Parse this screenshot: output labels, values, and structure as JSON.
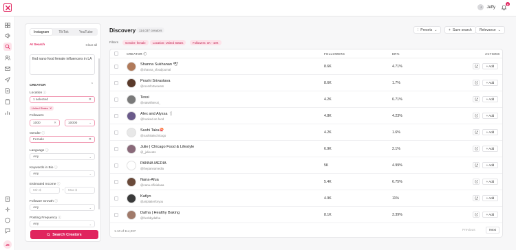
{
  "app": {
    "user_name": "Jeffy",
    "user_initial": "J",
    "notification_count": "8",
    "me_initials": "JE"
  },
  "filters_panel": {
    "tabs": [
      {
        "label": "Instagram",
        "active": true
      },
      {
        "label": "TikTok",
        "active": false
      },
      {
        "label": "YouTube",
        "active": false
      }
    ],
    "ai_search_label": "AI Search",
    "clear_all": "Clear all",
    "ai_query": "find nano food female influencers in LA",
    "creator_section": "CREATOR",
    "location_label": "Location",
    "location_value": "1 selected",
    "location_chip": "United States",
    "followers_label": "Followers",
    "followers_min": "1000",
    "followers_max": "10000",
    "gender_label": "Gender",
    "gender_value": "Female",
    "language_label": "Language",
    "language_value": "Any",
    "keywords_label": "Keywords in Bio",
    "keywords_value": "Any",
    "income_label": "Estimated Income",
    "income_min_placeholder": "Min $",
    "income_max_placeholder": "Max $",
    "growth_label": "Follower Growth",
    "growth_value": "Any",
    "posting_label": "Posting Frequency",
    "posting_value": "Any",
    "search_button": "Search Creators"
  },
  "main": {
    "title": "Discovery",
    "count_badge": "114,037 creators",
    "presets_button": "Presets",
    "save_search_button": "Save search",
    "relevance_button": "Relevance",
    "filters_label": "Filters",
    "filter_chips": [
      "Gender: female",
      "Location: United States",
      "Followers: 1K - 10K"
    ],
    "columns": {
      "creator": "CREATOR",
      "followers": "FOLLOWERS",
      "er": "ER%",
      "actions": "ACTIONS"
    },
    "add_label": "+ Add",
    "rows": [
      {
        "name": "Shanna Sukhanan 🕊",
        "handle": "@shanna_sfoodjournal",
        "followers": "8.6K",
        "er": "4.71%",
        "color": "#b07a5a"
      },
      {
        "name": "Prashi Srivastava",
        "handle": "@roomfortwoeats",
        "followers": "8.6K",
        "er": "1.7%",
        "color": "#5a3a2a"
      },
      {
        "name": "Tessi",
        "handle": "@eatwithtessi_",
        "followers": "4.2K",
        "er": "6.71%",
        "color": "#7a7a7a"
      },
      {
        "name": "Alex and Alyssa 🍴",
        "handle": "@hooked.on.food",
        "followers": "4.8K",
        "er": "4.23%",
        "color": "#6a5a8a"
      },
      {
        "name": "Sushi Taku🍣",
        "handle": "@sushitakuchicago",
        "followers": "4.2K",
        "er": "1.6%",
        "color": "#e8e8e8"
      },
      {
        "name": "Julie | Chicago Food & Lifestyle",
        "handle": "@_julieeats",
        "followers": "6.9K",
        "er": "2.1%",
        "color": "#8a6a7a"
      },
      {
        "name": "PANNA MEDIA",
        "handle": "@thepannamedia",
        "followers": "5K",
        "er": "4.99%",
        "color": "#ffffff"
      },
      {
        "name": "Nana-Afua",
        "handle": "@nana.officialaaa",
        "followers": "5.4K",
        "er": "6.75%",
        "color": "#6a4a3a"
      },
      {
        "name": "Katlyn",
        "handle": "@artplatterforyou",
        "followers": "4.9K",
        "er": "11%",
        "color": "#3a3a3a"
      },
      {
        "name": "Dafna | Healthy Baking",
        "handle": "@freshbydafna",
        "followers": "8.1K",
        "er": "3.39%",
        "color": "#a07a6a"
      }
    ],
    "pagination_text": "1-10 of 114,037",
    "previous": "Previous",
    "next": "Next"
  }
}
